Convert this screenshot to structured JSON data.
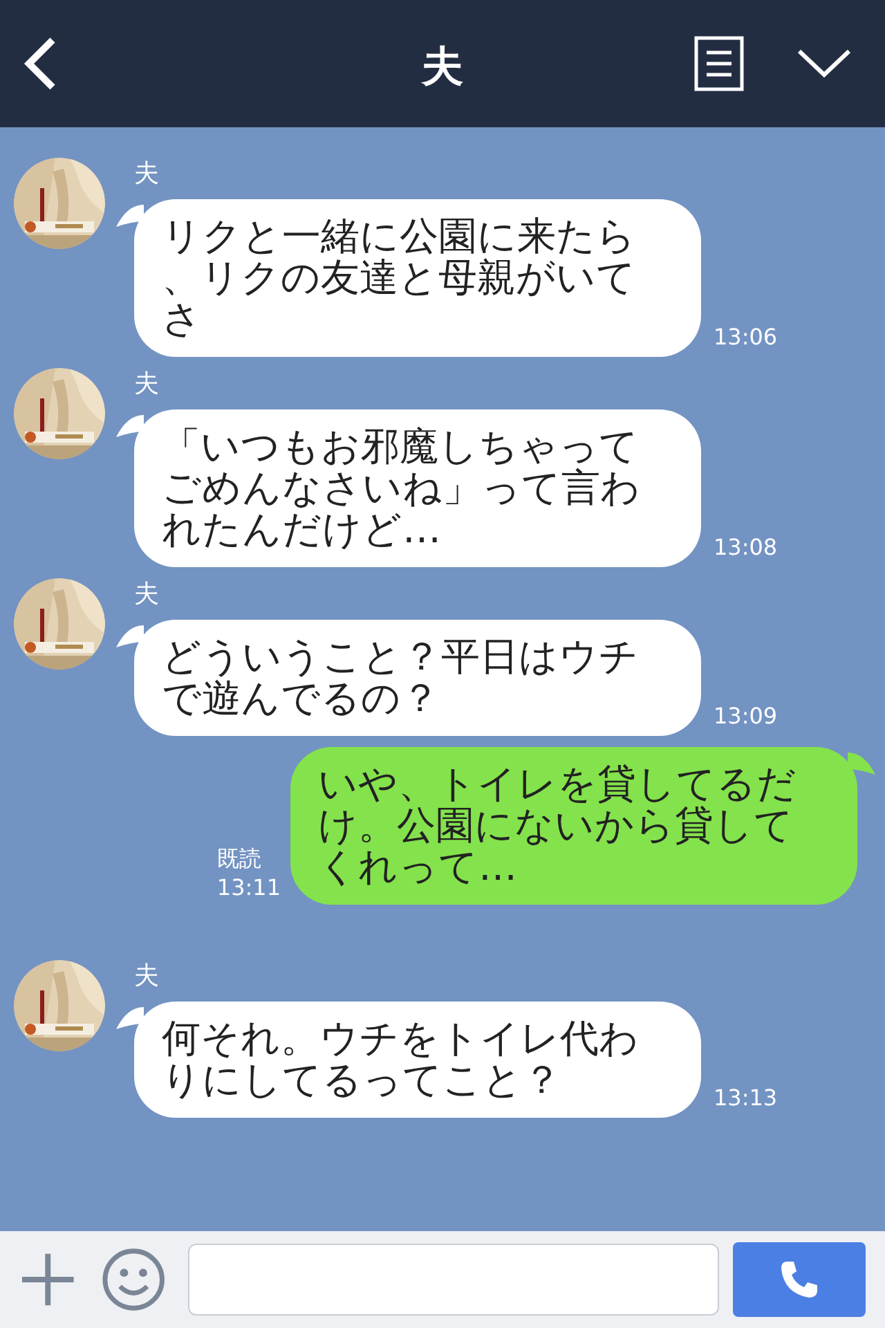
{
  "header": {
    "title": "夫"
  },
  "messages": [
    {
      "kind": "received",
      "sender": "夫",
      "text": "リクと一緒に公園に来たら、リクの友達と母親がいてさ",
      "time": "13:06"
    },
    {
      "kind": "received",
      "sender": "夫",
      "text": "「いつもお邪魔しちゃってごめんなさいね」って言われたんだけど…",
      "time": "13:08"
    },
    {
      "kind": "received",
      "sender": "夫",
      "text": "どういうこと？平日はウチで遊んでるの？",
      "time": "13:09"
    },
    {
      "kind": "sent",
      "text": "いや、トイレを貸してるだけ。公園にないから貸してくれって…",
      "read": "既読",
      "time": "13:11"
    },
    {
      "kind": "received",
      "sender": "夫",
      "text": "何それ。ウチをトイレ代わりにしてるってこと？",
      "time": "13:13"
    }
  ]
}
